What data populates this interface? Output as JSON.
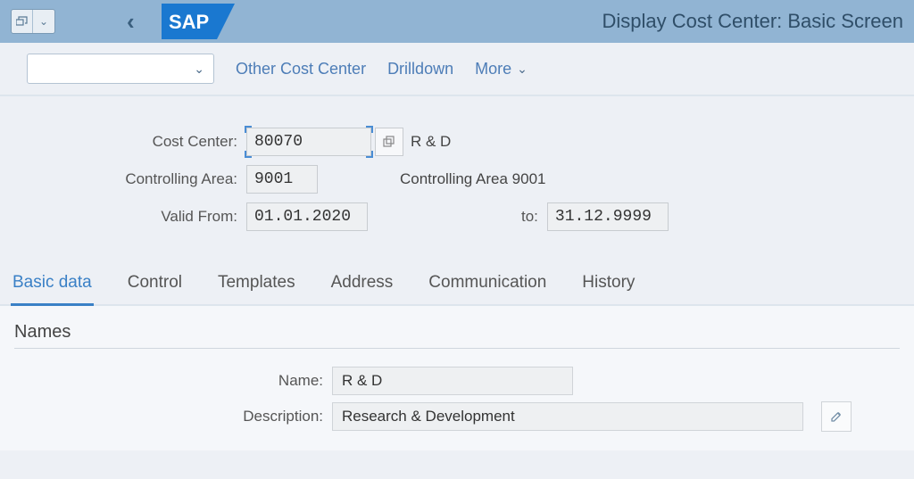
{
  "header": {
    "title": "Display Cost Center: Basic Screen",
    "logo": "SAP"
  },
  "toolbar": {
    "dropdown_value": "",
    "other_cost_center": "Other Cost Center",
    "drilldown": "Drilldown",
    "more": "More"
  },
  "form": {
    "cost_center_label": "Cost Center:",
    "cost_center_value": "80070",
    "cost_center_text": "R & D",
    "controlling_area_label": "Controlling Area:",
    "controlling_area_value": "9001",
    "controlling_area_text": "Controlling Area 9001",
    "valid_from_label": "Valid From:",
    "valid_from_value": "01.01.2020",
    "to_label": "to:",
    "to_value": "31.12.9999"
  },
  "tabs": {
    "basic_data": "Basic data",
    "control": "Control",
    "templates": "Templates",
    "address": "Address",
    "communication": "Communication",
    "history": "History"
  },
  "names": {
    "section_title": "Names",
    "name_label": "Name:",
    "name_value": "R & D",
    "description_label": "Description:",
    "description_value": "Research & Development"
  }
}
